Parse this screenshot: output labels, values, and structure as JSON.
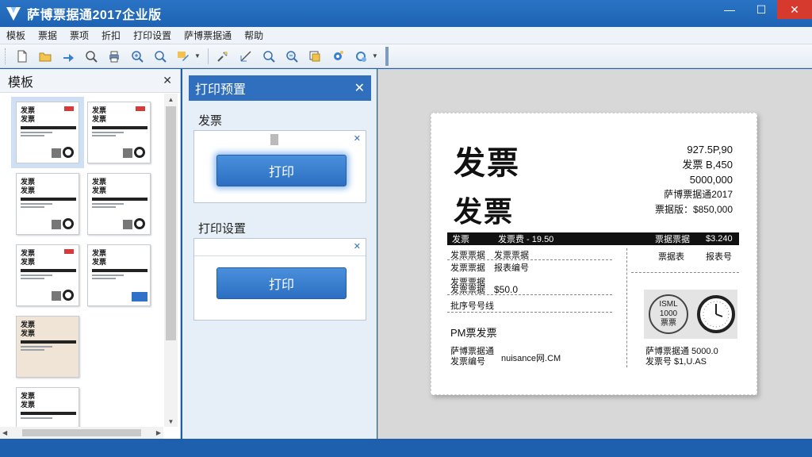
{
  "app": {
    "title": "萨博票据通2017企业版",
    "minimize_glyph": "—",
    "maximize_glyph": "☐",
    "close_glyph": "✕"
  },
  "menu": [
    "模板",
    "票据",
    "票项",
    "折扣",
    "打印设置",
    "萨博票据通",
    "帮助"
  ],
  "toolbar": {
    "icons": [
      "new-file-icon",
      "open-folder-icon",
      "export-icon",
      "zoom-icon",
      "print-icon",
      "zoom-in-icon",
      "search-icon",
      "edit-icon",
      "tools-icon",
      "line-icon",
      "search-icon",
      "zoom-out-icon",
      "layer-icon",
      "settings-icon",
      "refresh-icon"
    ],
    "dropdown_glyph": "▼"
  },
  "templates_panel": {
    "title": "模板",
    "close_glyph": "✕",
    "thumb_title": "发票",
    "thumb_title2": "发票",
    "scroll_up": "▲",
    "scroll_down": "▼",
    "scroll_left": "◀",
    "scroll_right": "▶"
  },
  "preview_panel": {
    "title": "打印预置",
    "close_glyph": "✕",
    "section1_label": "发票",
    "section2_label": "打印设置",
    "box_close_glyph": "✕",
    "print_button": "打印",
    "print_button2": "打印"
  },
  "invoice": {
    "heading1": "发票",
    "heading2": "发票",
    "right_lines": [
      "927.5P,90",
      "发票 B,450",
      "5000,000",
      "萨博票据通2017",
      "票据版：$850,000"
    ],
    "bar_cells": [
      "发票",
      "发票费 - 19.50",
      "票据票据",
      "$3.240"
    ],
    "rows": [
      {
        "left": "发票票据",
        "right": "发票票据"
      },
      {
        "left": "发票票据",
        "right": "报表编号"
      },
      {
        "left": "发票票据",
        "right": "$50.0"
      },
      {
        "left": "发票票据",
        "right": ""
      },
      {
        "left": "批序号号线",
        "right": ""
      }
    ],
    "right_col": [
      "票据表",
      "报表号"
    ],
    "pm_label": "PM票发票",
    "footer_left": [
      "萨博票据通",
      "发票编号"
    ],
    "footer_mid": "nuisance网.CM",
    "footer_right": [
      "萨博票据通 5000.0",
      "发票号 $1,U.AS"
    ],
    "stamp_lines": [
      "ISML",
      "1000",
      "票票"
    ]
  },
  "colors": {
    "titlebar": "#1e63b3",
    "accent": "#2f6fbd",
    "close_btn": "#d6392e"
  }
}
